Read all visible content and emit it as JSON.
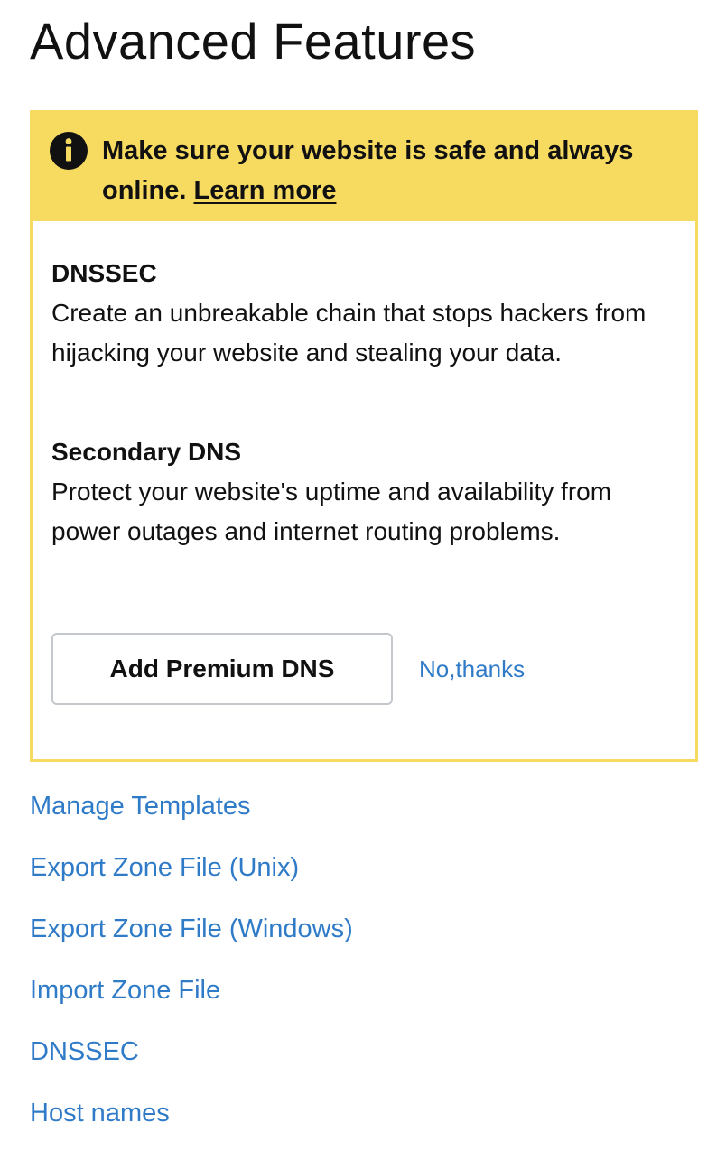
{
  "page": {
    "title": "Advanced Features"
  },
  "promo": {
    "banner_text": "Make sure your website is safe and always online.",
    "learn_more_label": "Learn more",
    "banner_color": "#f7db61",
    "info_icon": "info-icon",
    "features": [
      {
        "title": "DNSSEC",
        "description": "Create an unbreakable chain that stops hackers from hijacking your website and stealing your data."
      },
      {
        "title": "Secondary DNS",
        "description": "Protect your website's uptime and availability from power outages and internet routing problems."
      }
    ],
    "primary_button_label": "Add Premium DNS",
    "dismiss_label": "No,thanks"
  },
  "links": {
    "color": "#2f7bc8",
    "items": [
      "Manage Templates",
      "Export Zone File (Unix)",
      "Export Zone File (Windows)",
      "Import Zone File",
      "DNSSEC",
      "Host names"
    ]
  }
}
